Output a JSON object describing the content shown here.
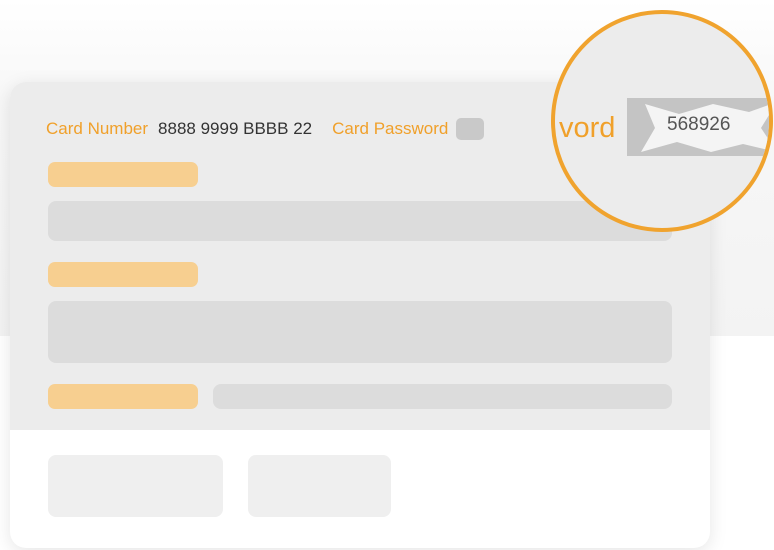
{
  "form": {
    "card_number_label": "Card Number",
    "card_number_value": "8888 9999 BBBB 22",
    "card_password_label": "Card Password"
  },
  "magnifier": {
    "label_fragment": "vord",
    "revealed_value": "568926"
  },
  "colors": {
    "accent": "#f0a02a",
    "placeholder_orange": "#f7cf90",
    "placeholder_gray": "#dcdcdc"
  }
}
